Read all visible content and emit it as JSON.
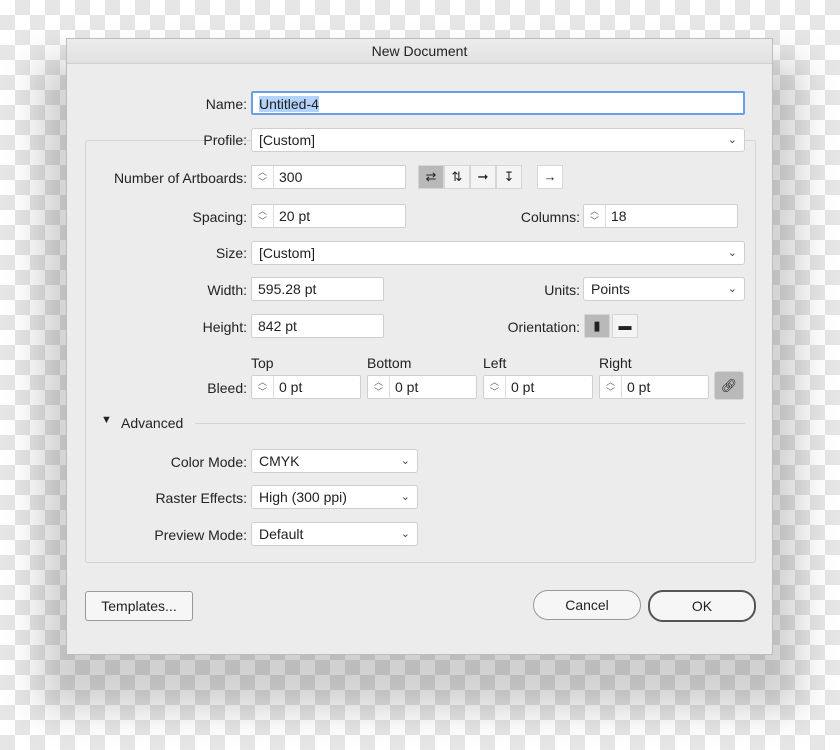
{
  "dialog": {
    "title": "New Document"
  },
  "name": {
    "label": "Name:",
    "value": "Untitled-4"
  },
  "profile": {
    "label": "Profile:",
    "value": "[Custom]"
  },
  "artboards": {
    "label": "Number of Artboards:",
    "value": "300"
  },
  "spacing": {
    "label": "Spacing:",
    "value": "20 pt"
  },
  "columns": {
    "label": "Columns:",
    "value": "18"
  },
  "size": {
    "label": "Size:",
    "value": "[Custom]"
  },
  "width": {
    "label": "Width:",
    "value": "595.28 pt"
  },
  "units": {
    "label": "Units:",
    "value": "Points"
  },
  "height": {
    "label": "Height:",
    "value": "842 pt"
  },
  "orientation": {
    "label": "Orientation:",
    "selected": "portrait"
  },
  "bleed": {
    "label": "Bleed:",
    "top_label": "Top",
    "top": "0 pt",
    "bottom_label": "Bottom",
    "bottom": "0 pt",
    "left_label": "Left",
    "left": "0 pt",
    "right_label": "Right",
    "right": "0 pt"
  },
  "advanced": {
    "label": "Advanced",
    "color_mode_label": "Color Mode:",
    "color_mode": "CMYK",
    "raster_label": "Raster Effects:",
    "raster": "High (300 ppi)",
    "preview_label": "Preview Mode:",
    "preview": "Default"
  },
  "buttons": {
    "templates": "Templates...",
    "cancel": "Cancel",
    "ok": "OK"
  }
}
